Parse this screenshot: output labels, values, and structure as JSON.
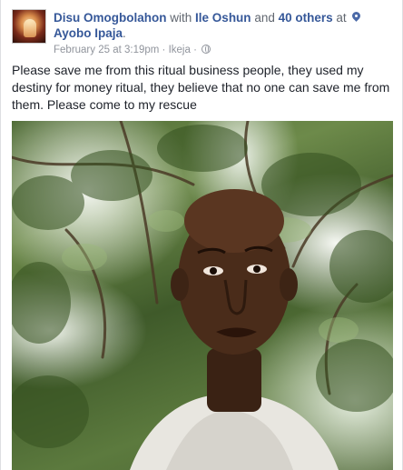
{
  "post": {
    "author": "Disu Omogbolahon",
    "with_word": "with",
    "tagged_person": "Ile Oshun",
    "and_word": "and",
    "others": "40 others",
    "at_word": "at",
    "location": "Ayobo Ipaja",
    "location_suffix": ".",
    "timestamp": "February 25 at 3:19pm",
    "separator": "·",
    "place": "Ikeja",
    "separator2": "·",
    "privacy_icon": "globe-icon",
    "location_icon": "pin-icon",
    "text": "Please save me from this ritual business people, they used my destiny for money ritual, they believe that no one can save me from them. Please come to my rescue"
  },
  "colors": {
    "link": "#365899",
    "text": "#1d2129",
    "meta": "#616770",
    "subtle": "#90949c"
  }
}
